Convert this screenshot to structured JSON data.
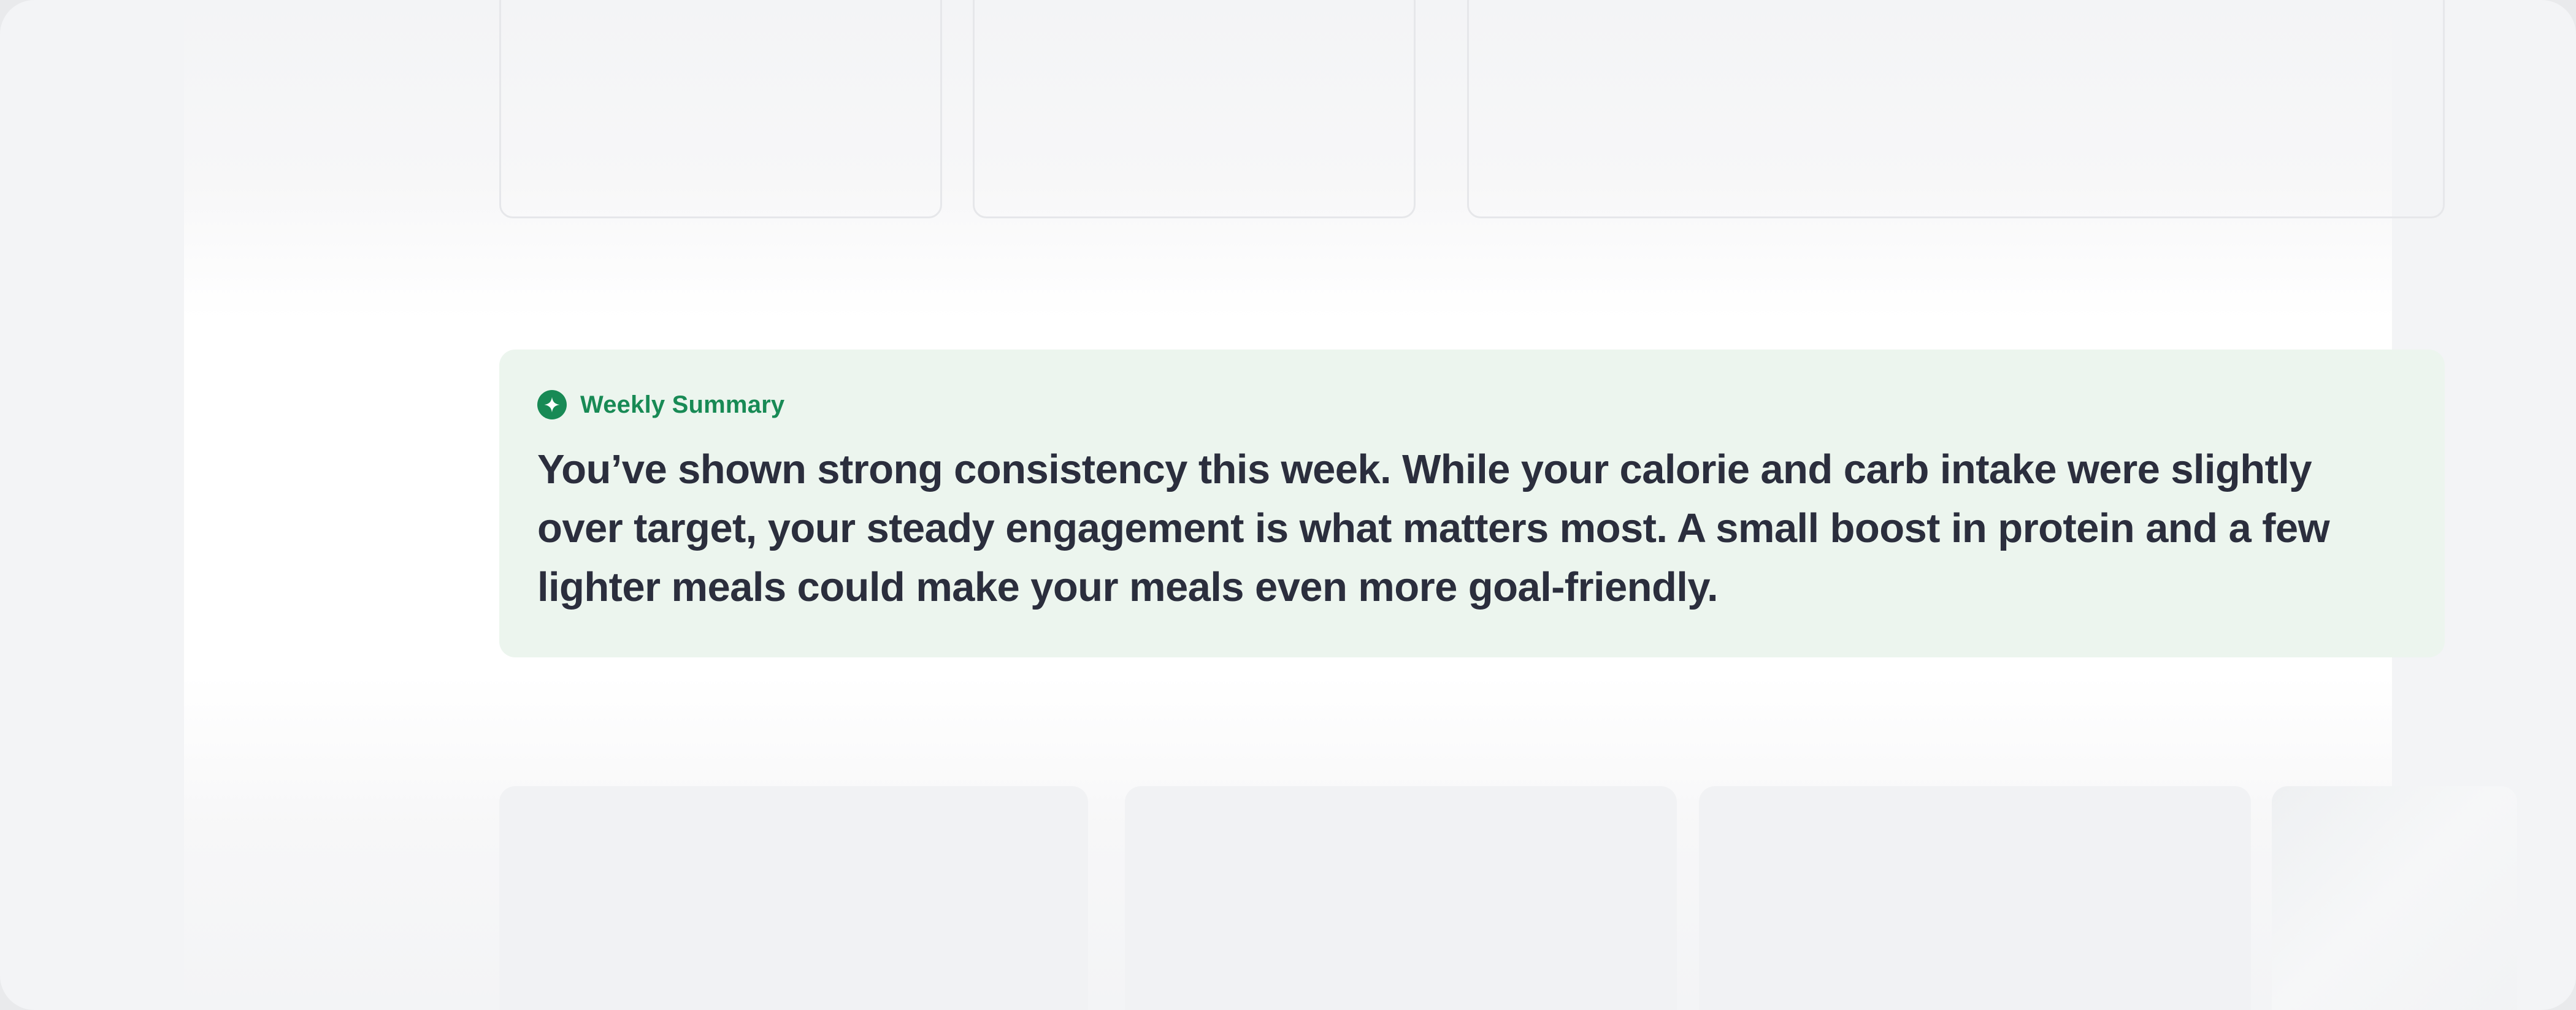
{
  "summary": {
    "title": "Weekly Summary",
    "icon": "sparkle-icon",
    "text": "You’ve shown strong consistency this week. While your calorie and carb intake were slightly over target, your steady engagement is what matters most. A small boost in protein and a few lighter meals could make your meals even more goal-friendly."
  },
  "colors": {
    "accent": "#188a55",
    "card_background": "#ecf5ee",
    "body_text": "#2b2e3d",
    "page_background": "#f3f4f6"
  }
}
